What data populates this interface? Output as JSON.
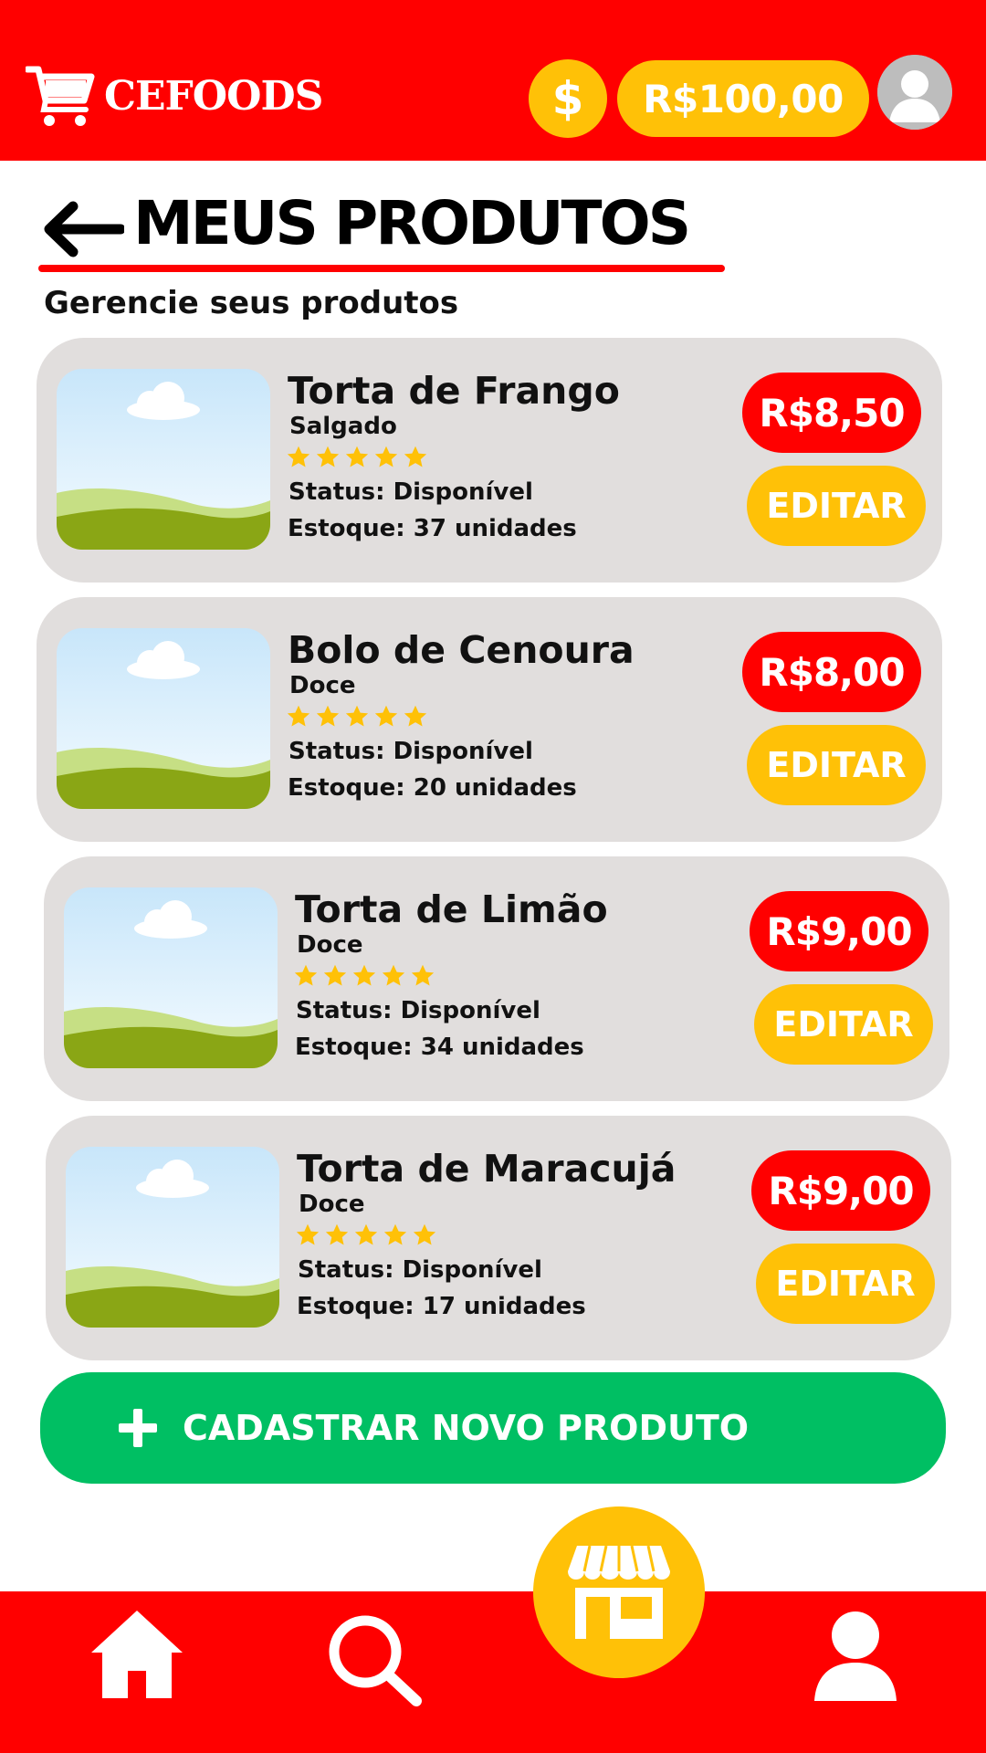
{
  "header": {
    "brand": "CEFOODS",
    "coin_symbol": "$",
    "balance": "R$100,00"
  },
  "page": {
    "title": "MEUS PRODUTOS",
    "subtitle": "Gerencie seus produtos"
  },
  "products": [
    {
      "name": "Torta de Frango",
      "category": "Salgado",
      "rating": 5,
      "status": "Status: Disponível",
      "stock": "Estoque: 37 unidades",
      "price": "R$8,50",
      "edit_label": "EDITAR"
    },
    {
      "name": "Bolo de Cenoura",
      "category": "Doce",
      "rating": 5,
      "status": "Status: Disponível",
      "stock": "Estoque: 20 unidades",
      "price": "R$8,00",
      "edit_label": "EDITAR"
    },
    {
      "name": "Torta de Limão",
      "category": "Doce",
      "rating": 5,
      "status": "Status: Disponível",
      "stock": "Estoque: 34 unidades",
      "price": "R$9,00",
      "edit_label": "EDITAR"
    },
    {
      "name": "Torta de Maracujá",
      "category": "Doce",
      "rating": 5,
      "status": "Status: Disponível",
      "stock": "Estoque: 17 unidades",
      "price": "R$9,00",
      "edit_label": "EDITAR"
    }
  ],
  "new_product_button": {
    "label": "CADASTRAR NOVO PRODUTO",
    "icon": "plus-icon"
  },
  "bottom_nav": {
    "items": [
      {
        "icon": "home-icon"
      },
      {
        "icon": "search-icon"
      },
      {
        "icon": "store-icon",
        "active": true
      },
      {
        "icon": "profile-icon"
      }
    ]
  },
  "colors": {
    "primary_red": "#ff0000",
    "accent_yellow": "#ffc107",
    "success_green": "#00bf63",
    "card_gray": "#e1dedd",
    "star_yellow": "#ffc107"
  }
}
